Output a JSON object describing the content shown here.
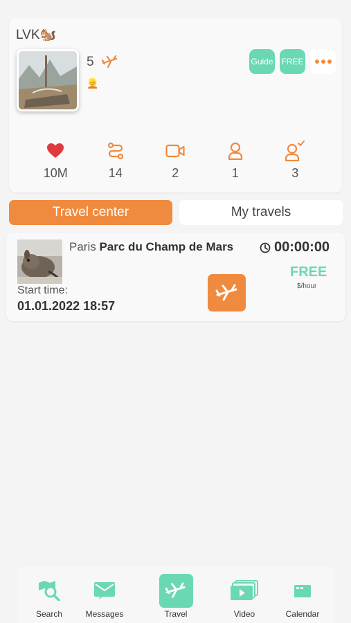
{
  "profile": {
    "username": "LVK🐿️",
    "rating": "5",
    "user_emoji": "👱",
    "badges": {
      "guide": "Guide",
      "free": "FREE"
    },
    "stats": [
      {
        "icon": "heart-icon",
        "value": "10M"
      },
      {
        "icon": "route-icon",
        "value": "14"
      },
      {
        "icon": "video-camera-icon",
        "value": "2"
      },
      {
        "icon": "user-icon",
        "value": "1"
      },
      {
        "icon": "user-check-icon",
        "value": "3"
      }
    ]
  },
  "tabs": {
    "travel_center": "Travel center",
    "my_travels": "My travels"
  },
  "travel": {
    "city": "Paris",
    "place": "Parc du Champ de Mars",
    "timer": "00:00:00",
    "price": "FREE",
    "price_unit": "$/hour",
    "start_label": "Start time:",
    "start_value": "01.01.2022 18:57"
  },
  "nav": {
    "search": "Search",
    "messages": "Messages",
    "travel": "Travel",
    "video": "Video",
    "calendar": "Calendar"
  },
  "colors": {
    "accent_orange": "#f08a3e",
    "accent_green": "#6bd8b4",
    "heart_red": "#e0393e"
  }
}
